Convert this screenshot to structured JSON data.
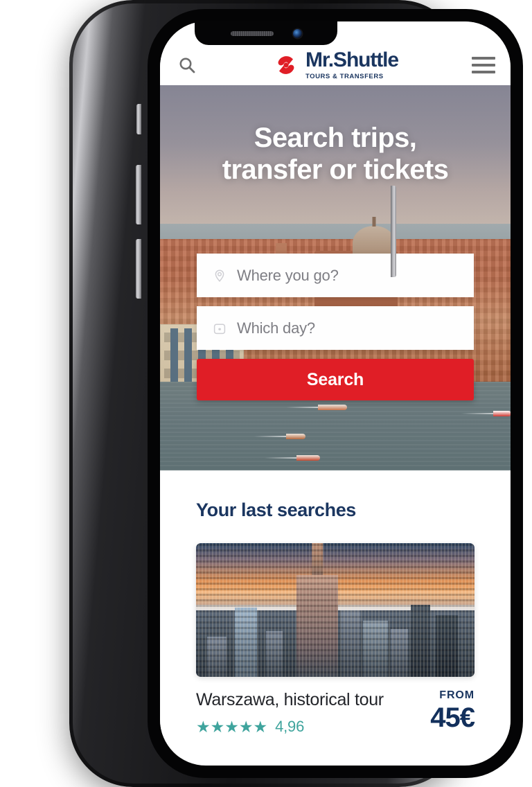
{
  "header": {
    "search_icon": "search-icon",
    "brand_name": "Mr.Shuttle",
    "brand_tagline": "TOURS & TRANSFERS",
    "menu_icon": "hamburger-menu-icon",
    "brand_color": "#1b3660",
    "logo_mark_color": "#e01e26"
  },
  "hero": {
    "title_line1": "Search trips,",
    "title_line2": "transfer or tickets",
    "image_description": "Venice lagoon cityscape with terracotta rooftops, church dome and boats"
  },
  "search_form": {
    "destination": {
      "placeholder": "Where you go?",
      "value": "",
      "icon": "location-pin-icon"
    },
    "date": {
      "placeholder": "Which day?",
      "value": "",
      "icon": "calendar-icon"
    },
    "submit_label": "Search",
    "submit_color": "#e01e26"
  },
  "last_searches": {
    "section_title": "Your last searches",
    "cards": [
      {
        "name": "Warszawa, historical tour",
        "image_description": "Warsaw skyline at sunset with Palace of Culture and Science",
        "stars": "★★★★★",
        "star_count": 5,
        "rating": "4,96",
        "rating_color": "#3fa49d",
        "price_label": "FROM",
        "price": "45€",
        "price_color": "#13305c"
      }
    ]
  },
  "device": {
    "speaker": "speaker-grille",
    "camera": "front-camera-icon",
    "buttons": [
      "mute-switch",
      "volume-up-button",
      "volume-down-button",
      "power-button"
    ]
  }
}
